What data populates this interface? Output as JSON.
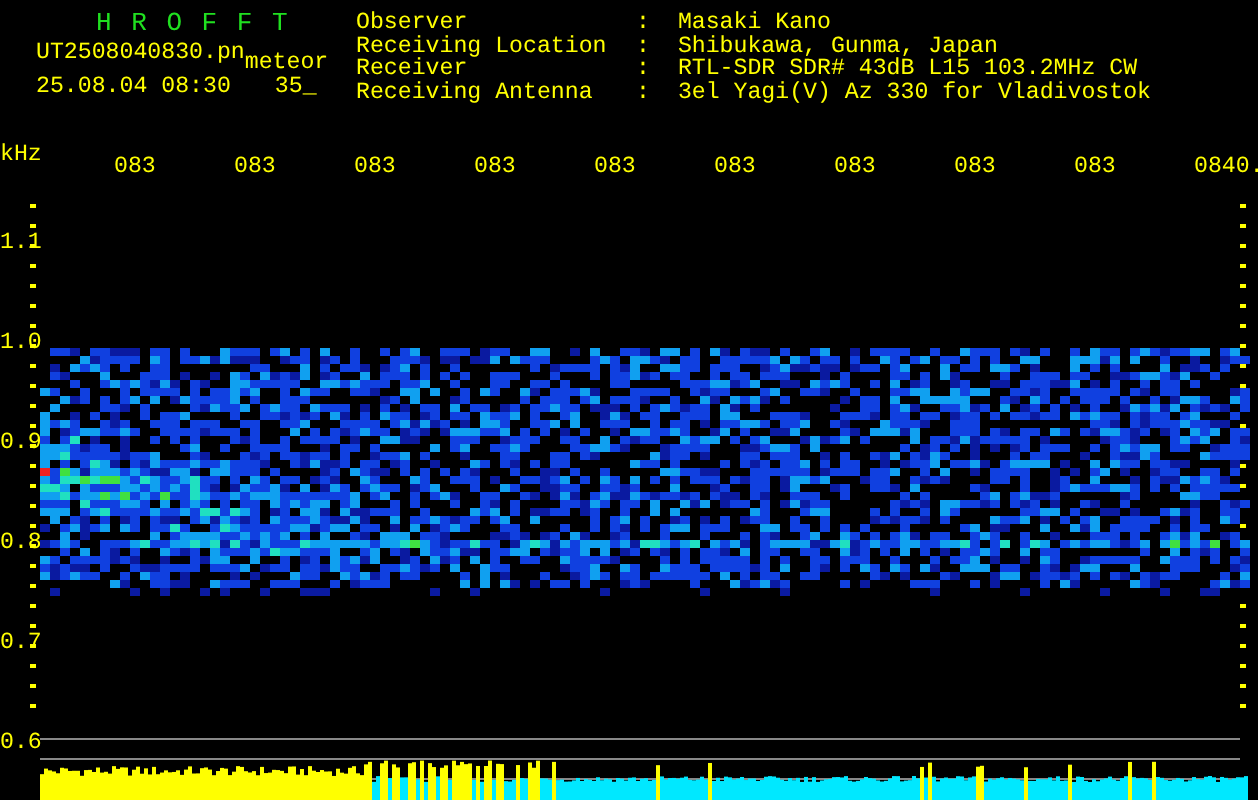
{
  "header": {
    "title": "H R O F F T",
    "file_name": "UT2508040830.pn",
    "mode": "meteor",
    "date_time": "25.08.04 08:30",
    "count": "35_"
  },
  "station_info": [
    {
      "label": "Observer",
      "separator": ":",
      "value": "Masaki Kano"
    },
    {
      "label": "Receiving Location",
      "separator": ":",
      "value": "Shibukawa, Gunma, Japan"
    },
    {
      "label": "Receiver",
      "separator": ":",
      "value": "RTL-SDR SDR# 43dB L15 103.2MHz CW"
    },
    {
      "label": "Receiving Antenna",
      "separator": ":",
      "value": "3el Yagi(V) Az 330 for Vladivostok"
    }
  ],
  "time_axis": [
    "083",
    "083",
    "083",
    "083",
    "083",
    "083",
    "083",
    "083",
    "083",
    "0840."
  ],
  "frequency_axis": {
    "unit": "kHz",
    "labels": [
      "1.1",
      "1.0",
      "0.9",
      "0.8",
      "0.7",
      "0.6"
    ]
  }
}
